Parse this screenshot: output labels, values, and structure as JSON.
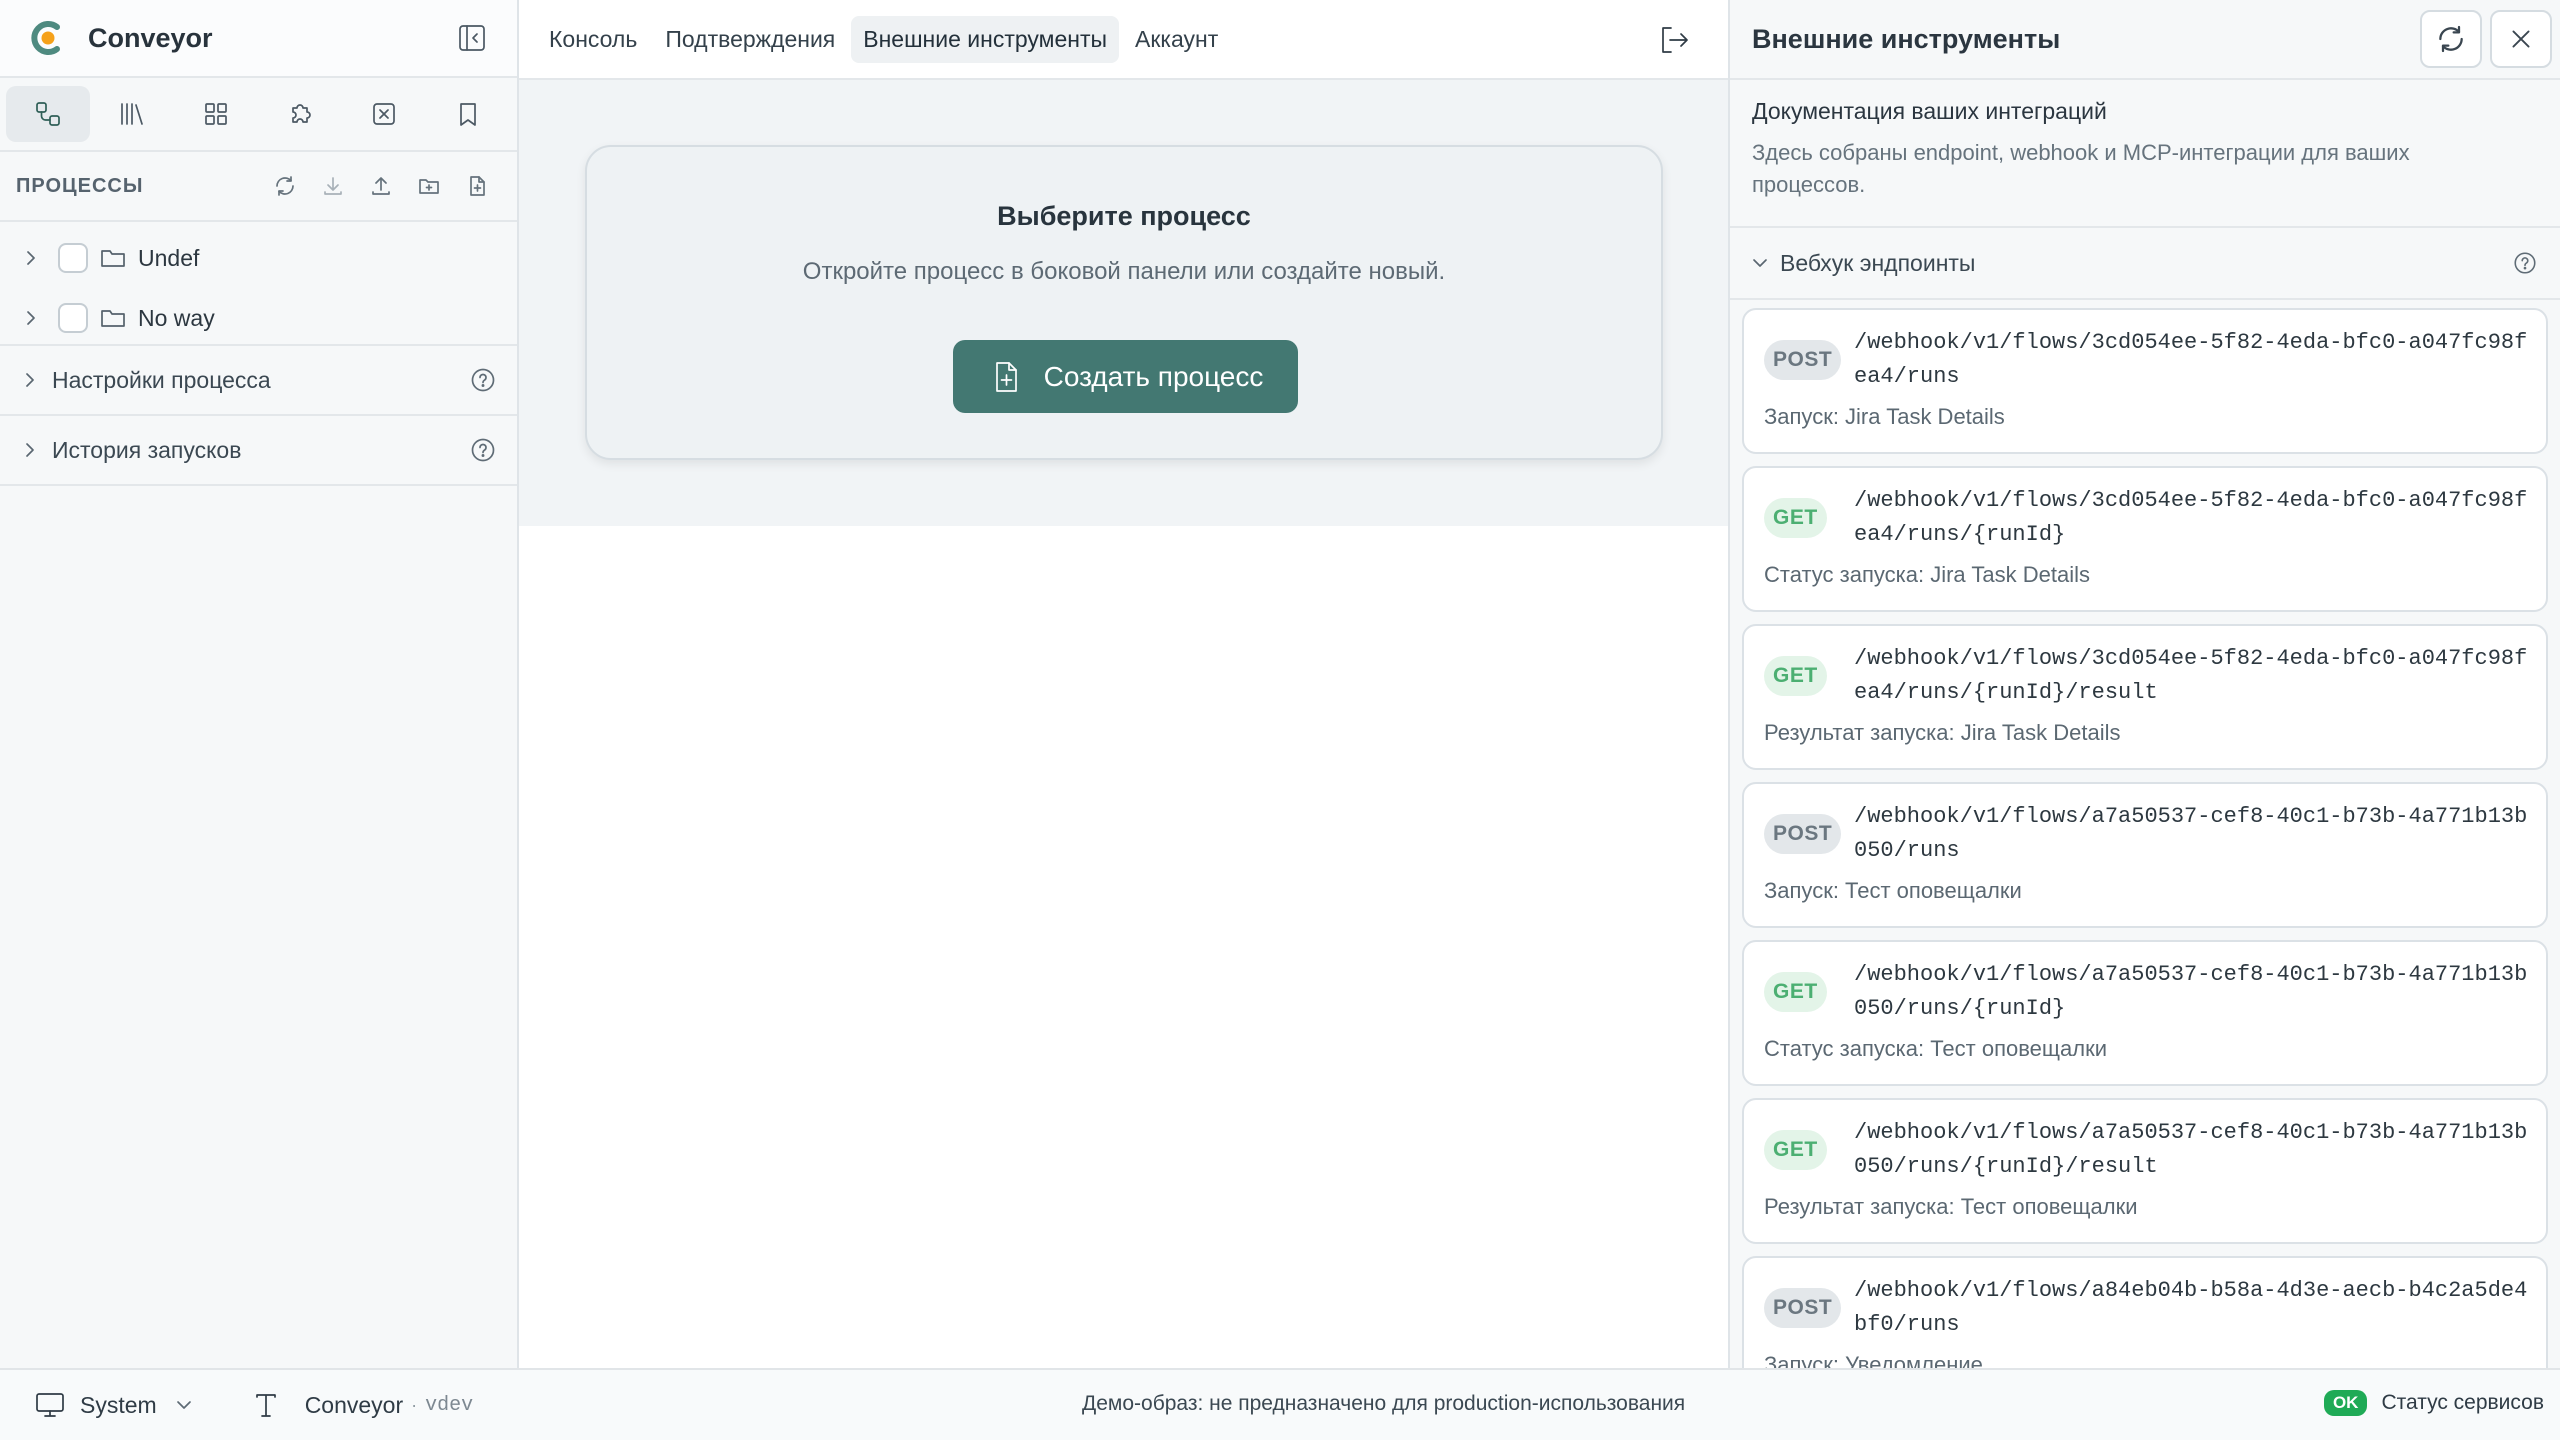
{
  "app": {
    "name": "Conveyor"
  },
  "sidebar": {
    "processes_title": "ПРОЦЕССЫ",
    "tree": [
      {
        "label": "Undef"
      },
      {
        "label": "No way"
      }
    ],
    "sections": [
      {
        "label": "Настройки процесса"
      },
      {
        "label": "История запусков"
      }
    ]
  },
  "topbar": {
    "tabs": [
      {
        "label": "Консоль"
      },
      {
        "label": "Подтверждения"
      },
      {
        "label": "Внешние инструменты"
      },
      {
        "label": "Аккаунт"
      }
    ],
    "active_tab": "Внешние инструменты"
  },
  "main": {
    "title": "Выберите процесс",
    "subtitle": "Откройте процесс в боковой панели или создайте новый.",
    "create_label": "Создать процесс"
  },
  "right_panel": {
    "title": "Внешние инструменты",
    "docs_title": "Документация ваших интеграций",
    "docs_desc": "Здесь собраны endpoint, webhook и MCP-интеграции для ваших процессов.",
    "section_title": "Вебхук эндпоинты",
    "endpoints": [
      {
        "method": "POST",
        "path": "/webhook/v1/flows/3cd054ee-5f82-4eda-bfc0-a047fc98fea4/runs",
        "desc": "Запуск: Jira Task Details"
      },
      {
        "method": "GET",
        "path": "/webhook/v1/flows/3cd054ee-5f82-4eda-bfc0-a047fc98fea4/runs/{runId}",
        "desc": "Статус запуска: Jira Task Details"
      },
      {
        "method": "GET",
        "path": "/webhook/v1/flows/3cd054ee-5f82-4eda-bfc0-a047fc98fea4/runs/{runId}/result",
        "desc": "Результат запуска: Jira Task Details"
      },
      {
        "method": "POST",
        "path": "/webhook/v1/flows/a7a50537-cef8-40c1-b73b-4a771b13b050/runs",
        "desc": "Запуск: Тест оповещалки"
      },
      {
        "method": "GET",
        "path": "/webhook/v1/flows/a7a50537-cef8-40c1-b73b-4a771b13b050/runs/{runId}",
        "desc": "Статус запуска: Тест оповещалки"
      },
      {
        "method": "GET",
        "path": "/webhook/v1/flows/a7a50537-cef8-40c1-b73b-4a771b13b050/runs/{runId}/result",
        "desc": "Результат запуска: Тест оповещалки"
      },
      {
        "method": "POST",
        "path": "/webhook/v1/flows/a84eb04b-b58a-4d3e-aecb-b4c2a5de4bf0/runs",
        "desc": "Запуск: Уведомление"
      }
    ]
  },
  "footer": {
    "theme": "System",
    "app_name": "Conveyor",
    "version": "vdev",
    "separator": "·",
    "demo_notice": "Демо-образ: не предназначено для production-использования",
    "status_badge": "OK",
    "status_label": "Статус сервисов"
  },
  "colors": {
    "accent": "#437872",
    "ok": "#1faa56",
    "get_badge": "#4caf72",
    "logo_orange": "#f5a11a",
    "logo_teal": "#4e8a80"
  }
}
